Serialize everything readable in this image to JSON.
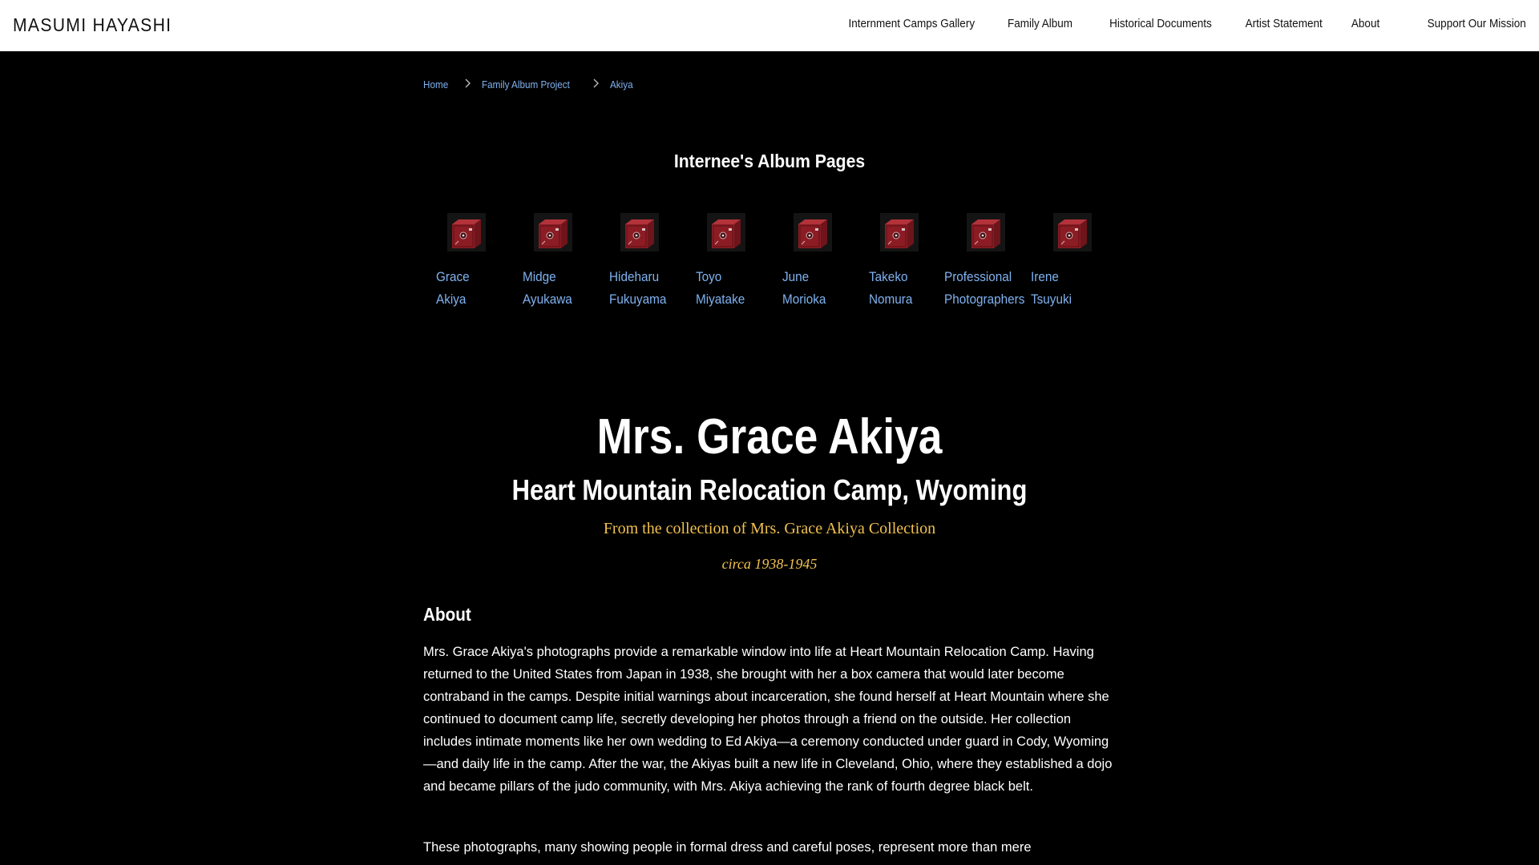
{
  "header": {
    "brand": "MASUMI HAYASHI",
    "nav": [
      "Internment Camps Gallery",
      "Family Album",
      "Historical Documents",
      "Artist Statement",
      "About",
      "Support Our Mission"
    ]
  },
  "breadcrumb": {
    "items": [
      "Home",
      "Family Album Project",
      "Akiya"
    ],
    "separator_icon": "chevron-right-icon"
  },
  "album": {
    "heading": "Internee's Album Pages",
    "icon": "red-box-camera-icon",
    "icon_color": "#8c1c24",
    "items": [
      {
        "first": "Grace",
        "last": "Akiya"
      },
      {
        "first": "Midge",
        "last": "Ayukawa"
      },
      {
        "first": "Hideharu",
        "last": "Fukuyama"
      },
      {
        "first": "Toyo",
        "last": "Miyatake"
      },
      {
        "first": "June",
        "last": "Morioka"
      },
      {
        "first": "Takeko",
        "last": "Nomura"
      },
      {
        "first": "Professional",
        "last": "Photographers"
      },
      {
        "first": "Irene",
        "last": "Tsuyuki"
      }
    ]
  },
  "main": {
    "title": "Mrs. Grace Akiya",
    "camp": "Heart Mountain Relocation Camp, Wyoming",
    "collection": "From the collection of Mrs. Grace Akiya Collection",
    "circa": "circa 1938-1945",
    "about_heading": "About",
    "about_paragraph_1": "Mrs. Grace Akiya's photographs provide a remarkable window into life at Heart Mountain Relocation Camp. Having returned to the United States from Japan in 1938, she brought with her a box camera that would later become contraband in the camps. Despite initial warnings about incarceration, she found herself at Heart Mountain where she continued to document camp life, secretly developing her photos through a friend on the outside. Her collection includes intimate moments like her own wedding to Ed Akiya—a ceremony conducted under guard in Cody, Wyoming—and daily life in the camp. After the war, the Akiyas built a new life in Cleveland, Ohio, where they established a dojo and became pillars of the judo community, with Mrs. Akiya achieving the rank of fourth degree black belt.",
    "about_paragraph_2": "These photographs, many showing people in formal dress and careful poses, represent more than mere"
  },
  "colors": {
    "link": "#7fb2f0",
    "accent_gold": "#f2c14e",
    "background": "#000000",
    "header_bg": "#ffffff"
  }
}
